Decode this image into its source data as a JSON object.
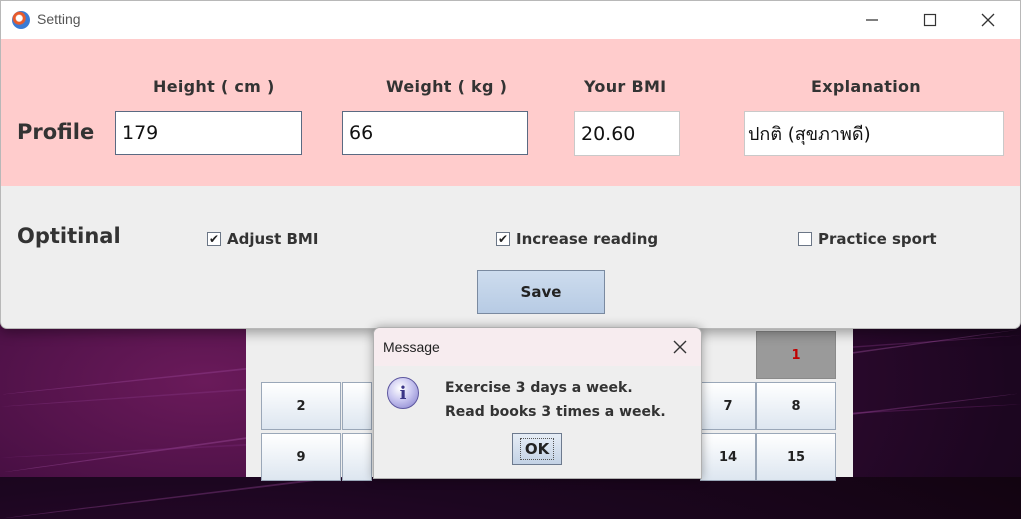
{
  "settings_window": {
    "title": "Setting",
    "controls": {
      "minimize": "—",
      "maximize": "☐",
      "close": "✕"
    },
    "profile": {
      "section_label": "Profile",
      "height_label": "Height ( cm )",
      "weight_label": "Weight ( kg )",
      "bmi_label": "Your BMI",
      "explanation_label": "Explanation",
      "height_value": "179",
      "weight_value": "66",
      "bmi_value": "20.60",
      "explanation_value": "ปกติ (สุขภาพดี)"
    },
    "optional": {
      "section_label": "Optitinal",
      "adjust_bmi": {
        "label": "Adjust BMI",
        "checked": true
      },
      "increase_reading": {
        "label": "Increase reading",
        "checked": true
      },
      "practice_sport": {
        "label": "Practice sport",
        "checked": false
      }
    },
    "save_label": "Save"
  },
  "calendar": {
    "cells": [
      {
        "text": "1",
        "highlight": true
      },
      {
        "text": "2"
      },
      {
        "text": "7"
      },
      {
        "text": "8"
      },
      {
        "text": "9"
      },
      {
        "text": "14"
      },
      {
        "text": "15"
      }
    ]
  },
  "message_dialog": {
    "title": "Message",
    "icon": "info-icon",
    "line1": "Exercise 3 days a week.",
    "line2": "Read books 3 times a week.",
    "ok_label": "OK"
  },
  "colors": {
    "profile_background": "#ffcccc",
    "window_background": "#eeeeee",
    "button_fill": "#c4d5ea",
    "calendar_highlight": "#9a9a9a",
    "calendar_highlight_text": "#c00000"
  }
}
